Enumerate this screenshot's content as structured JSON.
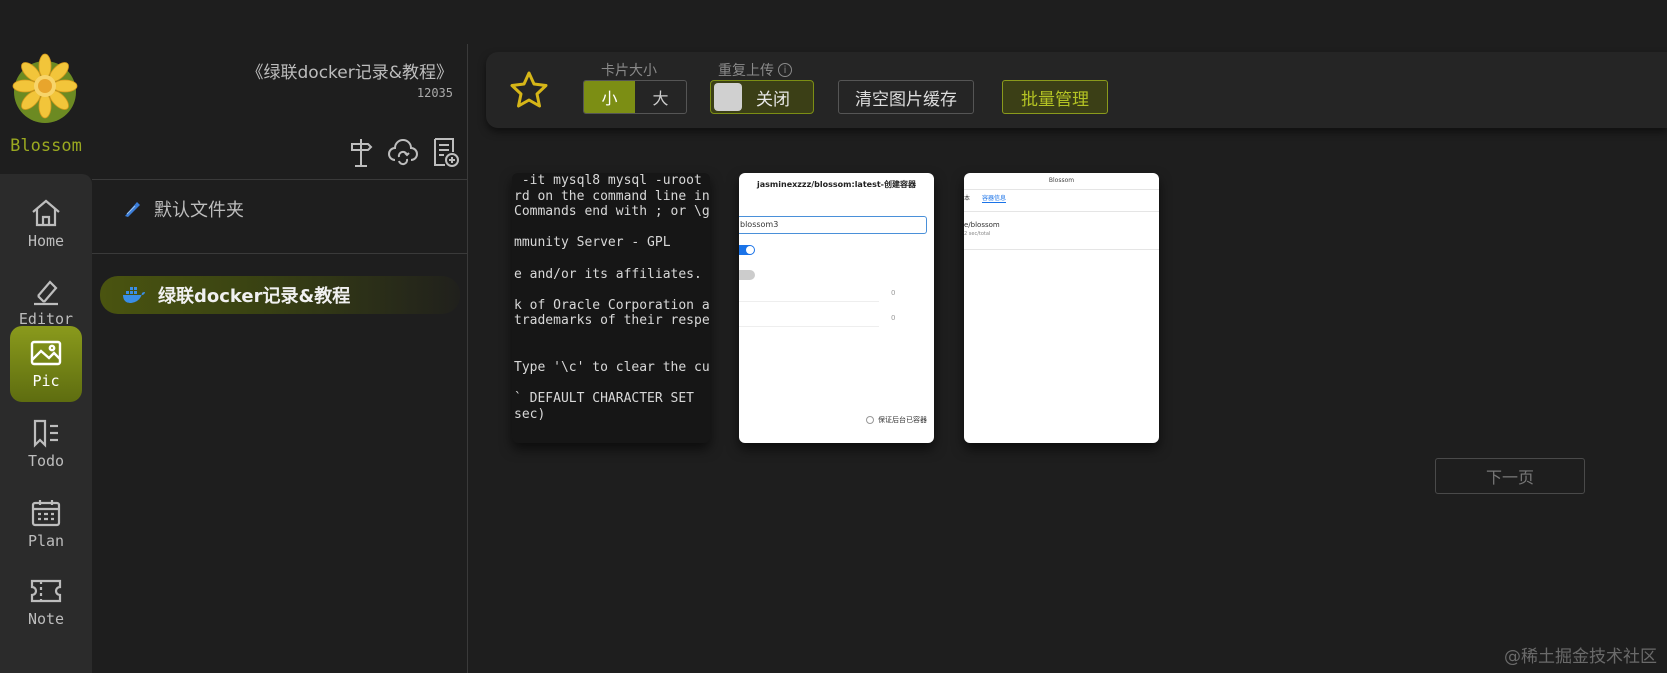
{
  "app": {
    "brand": "Blossom"
  },
  "nav": {
    "items": [
      {
        "label": "Home",
        "icon": "home-icon"
      },
      {
        "label": "Editor",
        "icon": "editor-icon"
      },
      {
        "label": "Pic",
        "icon": "image-icon",
        "active": true
      },
      {
        "label": "Todo",
        "icon": "todo-icon"
      },
      {
        "label": "Plan",
        "icon": "calendar-icon"
      },
      {
        "label": "Note",
        "icon": "note-icon"
      }
    ]
  },
  "folder_panel": {
    "title": "《绿联docker记录&教程》",
    "count": "12035",
    "folders": [
      {
        "label": "默认文件夹",
        "icon": "feather-icon"
      },
      {
        "label": "绿联docker记录&教程",
        "icon": "docker-icon",
        "active": true
      }
    ]
  },
  "toolbar": {
    "card_size_label": "卡片大小",
    "size_options": [
      "小",
      "大"
    ],
    "size_selected": "小",
    "duplicate_label": "重复上传",
    "duplicate_toggle_label": "关闭",
    "clear_cache_label": "清空图片缓存",
    "batch_manage_label": "批量管理"
  },
  "cards": {
    "terminal_lines": [
      " -it mysql8 mysql -uroot",
      "rd on the command line in",
      "Commands end with ; or \\g",
      "",
      "mmunity Server - GPL",
      "",
      "e and/or its affiliates.",
      "",
      "k of Oracle Corporation a",
      "trademarks of their respe",
      "",
      "",
      "Type '\\c' to clear the cu",
      "",
      "` DEFAULT CHARACTER SET",
      "sec)"
    ],
    "card2": {
      "title": "jasminexzzz/blossom:latest-创建容器",
      "input_value": "blossom3",
      "num1": "0",
      "num2": "0",
      "checkbox_label": "保证后台已容器"
    },
    "card3": {
      "header": "Blossom",
      "tab1": "本",
      "tab2": "容器信息",
      "text": "e/blossom",
      "sub": "2 sec/total"
    }
  },
  "pagination": {
    "next_label": "下一页"
  },
  "watermark": "@稀土掘金技术社区",
  "colors": {
    "accent": "#7c8e14",
    "brand_text": "#9aa820",
    "background": "#1e1e1e"
  }
}
